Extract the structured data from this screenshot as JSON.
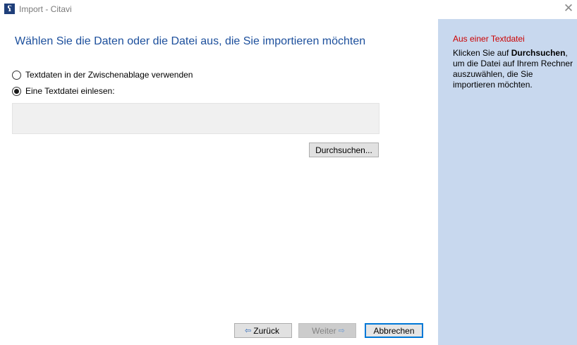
{
  "window": {
    "title": "Import - Citavi",
    "app_icon_glyph": "ʕ",
    "close_glyph": "✕"
  },
  "heading": "Wählen Sie die Daten oder die Datei aus, die Sie importieren möchten",
  "options": [
    {
      "label": "Textdaten in der Zwischenablage verwenden",
      "checked": false
    },
    {
      "label": "Eine Textdatei einlesen:",
      "checked": true
    }
  ],
  "file_field": {
    "value": ""
  },
  "browse_button": {
    "label": "Durchsuchen..."
  },
  "nav": {
    "back": {
      "label": "Zurück",
      "icon": "arrow-left-icon",
      "glyph": "⇦"
    },
    "next": {
      "label": "Weiter",
      "icon": "arrow-right-icon",
      "glyph": "⇨",
      "enabled": false
    },
    "cancel": {
      "label": "Abbrechen"
    }
  },
  "help": {
    "title": "Aus einer Textdatei",
    "text_before": "Klicken Sie auf ",
    "text_bold": "Durchsuchen",
    "text_after": ", um die Datei auf Ihrem Rechner auszuwählen, die Sie importieren möchten."
  },
  "colors": {
    "heading": "#1c4f9c",
    "help_panel_bg": "#c8d8ee",
    "help_title": "#cc0000",
    "accent": "#0078d7"
  }
}
